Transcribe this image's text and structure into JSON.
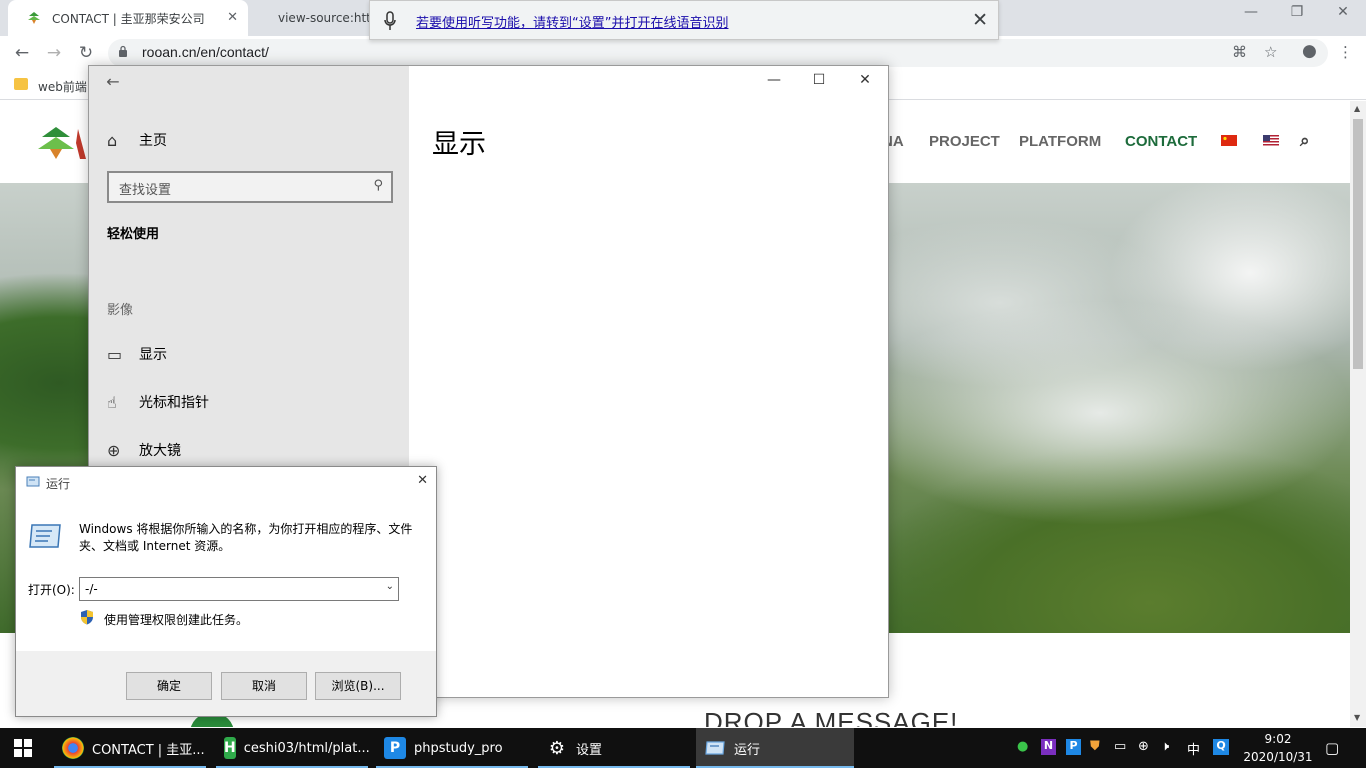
{
  "browser": {
    "tabs": [
      {
        "title": "CONTACT | 圭亚那荣安公司"
      },
      {
        "title": "view-source:htt"
      }
    ],
    "url": "rooan.cn/en/contact/",
    "bookmark": "web前端"
  },
  "speech_bar": {
    "text": "若要使用听写功能，请转到“设置”并打开在线语音识别"
  },
  "website": {
    "nav": [
      "NA",
      "PROJECT",
      "PLATFORM",
      "CONTACT"
    ],
    "active_nav": "CONTACT",
    "message_heading": "DROP A MESSAGE!"
  },
  "settings": {
    "home": "主页",
    "search_placeholder": "查找设置",
    "category": "轻松使用",
    "section": "影像",
    "items": [
      "显示",
      "光标和指针",
      "放大镜"
    ],
    "page_title": "显示"
  },
  "run_dialog": {
    "title": "运行",
    "description": "Windows 将根据你所输入的名称，为你打开相应的程序、文件夹、文档或 Internet 资源。",
    "open_label": "打开(O):",
    "open_value": "-/-",
    "admin_text": "使用管理权限创建此任务。",
    "buttons": {
      "ok": "确定",
      "cancel": "取消",
      "browse": "浏览(B)..."
    }
  },
  "taskbar": {
    "apps": [
      {
        "label": "CONTACT | 圭亚...",
        "icon": "chrome-icon"
      },
      {
        "label": "ceshi03/html/plat...",
        "icon": "hbuilder-icon"
      },
      {
        "label": "phpstudy_pro",
        "icon": "phpstudy-icon"
      },
      {
        "label": "设置",
        "icon": "gear-icon"
      },
      {
        "label": "运行",
        "icon": "run-icon"
      }
    ],
    "ime": "中",
    "time": "9:02",
    "date": "2020/10/31"
  },
  "colors": {
    "site_accent": "#1d6b3b",
    "taskbar_bg": "#101010",
    "settings_sidebar": "#e6e6e6",
    "link_blue": "#1a0dab"
  }
}
